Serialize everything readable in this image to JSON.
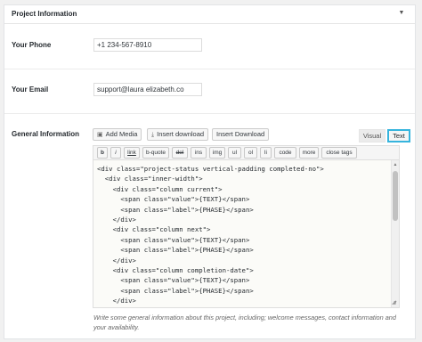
{
  "panel": {
    "title": "Project Information",
    "toggle_icon": "triangle-down"
  },
  "fields": {
    "phone": {
      "label": "Your Phone",
      "value": "+1 234-567-8910"
    },
    "email": {
      "label": "Your Email",
      "value": "support@laura elizabeth.co"
    },
    "general": {
      "label": "General Information"
    }
  },
  "media_buttons": {
    "add_media": "Add Media",
    "insert_download": "Insert download",
    "insert_download_2": "Insert Download"
  },
  "tabs": {
    "visual": "Visual",
    "text": "Text",
    "active": "text",
    "active_color": "#36b4dd"
  },
  "quicktags": [
    "b",
    "i",
    "link",
    "b-quote",
    "del",
    "ins",
    "img",
    "ul",
    "ol",
    "li",
    "code",
    "more",
    "close tags"
  ],
  "editor": {
    "content": "<div class=\"project-status vertical-padding completed-no\">\n  <div class=\"inner-width\">\n    <div class=\"column current\">\n      <span class=\"value\">{TEXT}</span>\n      <span class=\"label\">{PHASE}</span>\n    </div>\n    <div class=\"column next\">\n      <span class=\"value\">{TEXT}</span>\n      <span class=\"label\">{PHASE}</span>\n    </div>\n    <div class=\"column completion-date\">\n      <span class=\"value\">{TEXT}</span>\n      <span class=\"label\">{PHASE}</span>\n    </div>"
  },
  "help_text": "Write some general information about this project, including; welcome messages, contact information and your availability."
}
